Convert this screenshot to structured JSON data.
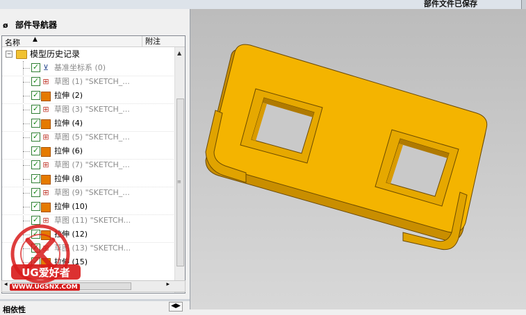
{
  "status": {
    "message": "部件文件已保存"
  },
  "navigator": {
    "title": "部件导航器",
    "columns": {
      "name": "名称",
      "note": "附注"
    },
    "root": {
      "label": "模型历史记录"
    },
    "features": [
      {
        "label": "基准坐标系 (0)",
        "type": "csys",
        "state": "dim"
      },
      {
        "label": "草图 (1) \"SKETCH_...",
        "type": "sketch",
        "state": "dim"
      },
      {
        "label": "拉伸 (2)",
        "type": "extrude",
        "state": "norm"
      },
      {
        "label": "草图 (3) \"SKETCH_...",
        "type": "sketch",
        "state": "dim"
      },
      {
        "label": "拉伸 (4)",
        "type": "extrude",
        "state": "norm"
      },
      {
        "label": "草图 (5) \"SKETCH_...",
        "type": "sketch",
        "state": "dim"
      },
      {
        "label": "拉伸 (6)",
        "type": "extrude",
        "state": "norm"
      },
      {
        "label": "草图 (7) \"SKETCH_...",
        "type": "sketch",
        "state": "dim"
      },
      {
        "label": "拉伸 (8)",
        "type": "extrude",
        "state": "norm"
      },
      {
        "label": "草图 (9) \"SKETCH_...",
        "type": "sketch",
        "state": "dim"
      },
      {
        "label": "拉伸 (10)",
        "type": "extrude",
        "state": "norm"
      },
      {
        "label": "草图 (11) \"SKETCH...",
        "type": "sketch",
        "state": "dim"
      },
      {
        "label": "拉伸 (12)",
        "type": "extrude",
        "state": "norm"
      },
      {
        "label": "草图 (13) \"SKETCH...",
        "type": "sketch",
        "state": "dim"
      },
      {
        "label": "拉伸 (15)",
        "type": "extrude",
        "state": "norm"
      }
    ],
    "bottom_title": "相依性"
  },
  "watermark": {
    "brand": "UG爱好者",
    "url": "WWW.UGSNX.COM"
  },
  "colors": {
    "part": "#f4b400",
    "part_edge": "#6b4a00",
    "viewport_top": "#bcbcbc",
    "viewport_bottom": "#d8d8d8"
  }
}
